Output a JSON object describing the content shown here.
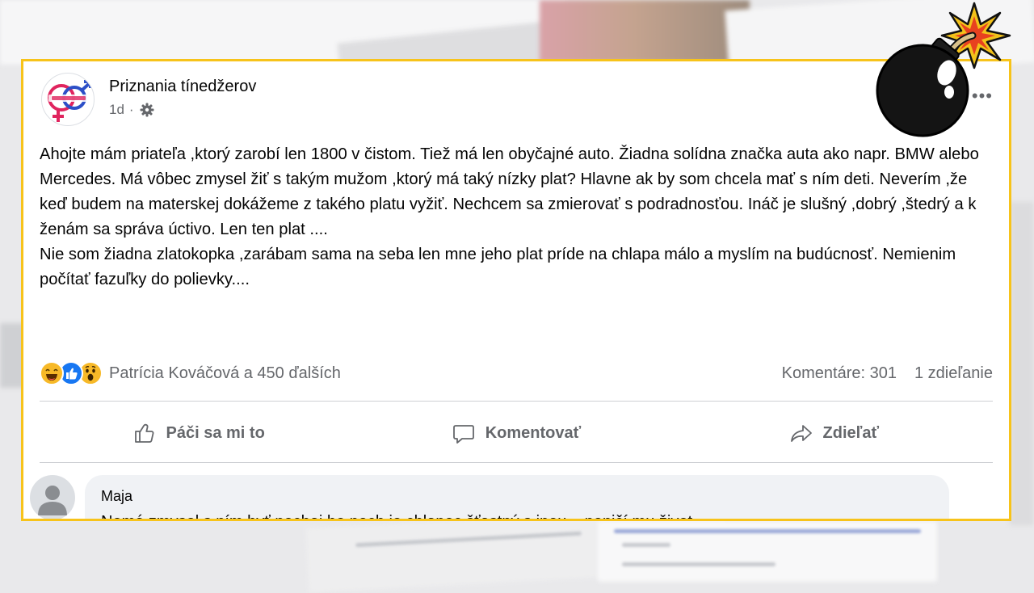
{
  "post": {
    "page_name": "Priznania tínedžerov",
    "time": "1d",
    "time_separator": "·",
    "more_menu": "•••",
    "body_paragraphs": [
      "Ahojte mám priateľa ,ktorý zarobí len 1800 v čistom. Tiež má len obyčajné auto. Žiadna solídna značka auta ako napr. BMW alebo Mercedes. Má vôbec zmysel žiť s takým mužom ,ktorý má taký nízky plat? Hlavne ak by som chcela mať s ním deti. Neverím ,že keď budem na materskej dokážeme z takého platu vyžiť. Nechcem sa zmierovať s podradnosťou. Ináč je slušný ,dobrý ,štedrý a k ženám sa správa úctivo. Len ten plat ....",
      "Nie som žiadna zlatokopka ,zarábam sama na seba len mne jeho plat príde na chlapa málo a myslím na budúcnosť. Nemienim počítať fazuľky do polievky...."
    ],
    "reactions_text": "Patrícia Kováčová a 450 ďalších",
    "comments_count": "Komentáre: 301",
    "shares_count": "1 zdieľanie",
    "reaction_icons": [
      "haha-icon",
      "like-icon",
      "wow-icon"
    ]
  },
  "actions": {
    "like": "Páči sa mi to",
    "comment": "Komentovať",
    "share": "Zdieľať"
  },
  "comment": {
    "author": "Maja",
    "text": "Nemá zmysel s ním byť nechaj ho nech je chlapec šťastný s inou ...neničí mu život"
  },
  "colors": {
    "frame": "#f7c31a",
    "text": "#050505",
    "secondary": "#65676b",
    "like_blue": "#1877f2",
    "reaction_yellow": "#f7b928"
  }
}
